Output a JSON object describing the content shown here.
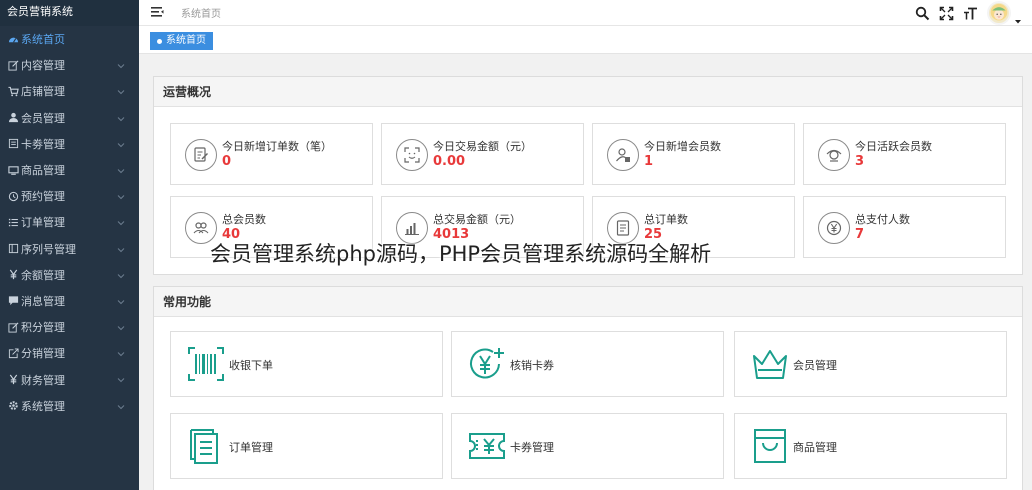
{
  "sidebar": {
    "brand": "会员营销系统",
    "items": [
      {
        "label": "系统首页",
        "icon": "dashboard-icon",
        "active": true
      },
      {
        "label": "内容管理",
        "icon": "edit-icon"
      },
      {
        "label": "店铺管理",
        "icon": "cart-icon"
      },
      {
        "label": "会员管理",
        "icon": "user-icon"
      },
      {
        "label": "卡劵管理",
        "icon": "card-icon"
      },
      {
        "label": "商品管理",
        "icon": "monitor-icon"
      },
      {
        "label": "预约管理",
        "icon": "clock-icon"
      },
      {
        "label": "订单管理",
        "icon": "list-icon"
      },
      {
        "label": "序列号管理",
        "icon": "serial-icon"
      },
      {
        "label": "余额管理",
        "icon": "yen-icon"
      },
      {
        "label": "消息管理",
        "icon": "message-icon"
      },
      {
        "label": "积分管理",
        "icon": "points-icon"
      },
      {
        "label": "分销管理",
        "icon": "share-icon"
      },
      {
        "label": "财务管理",
        "icon": "finance-yen-icon"
      },
      {
        "label": "系统管理",
        "icon": "gear-icon"
      }
    ]
  },
  "topbar": {
    "breadcrumb": "系统首页",
    "icons": [
      "search-icon",
      "fullscreen-icon",
      "font-size-icon",
      "avatar",
      "chevron-down-icon"
    ]
  },
  "tabs": [
    {
      "label": "系统首页"
    }
  ],
  "overview": {
    "title": "运营概况",
    "stats": [
      {
        "label": "今日新增订单数（笔）",
        "value": "0",
        "icon": "order-edit-icon"
      },
      {
        "label": "今日交易金额（元）",
        "value": "0.00",
        "icon": "scan-icon"
      },
      {
        "label": "今日新增会员数",
        "value": "1",
        "icon": "member-add-icon"
      },
      {
        "label": "今日活跃会员数",
        "value": "3",
        "icon": "active-member-icon"
      },
      {
        "label": "总会员数",
        "value": "40",
        "icon": "group-icon"
      },
      {
        "label": "总交易金额（元）",
        "value": "4013",
        "icon": "bar-chart-icon"
      },
      {
        "label": "总订单数",
        "value": "25",
        "icon": "document-icon"
      },
      {
        "label": "总支付人数",
        "value": "7",
        "icon": "yen-circle-icon"
      }
    ]
  },
  "functions": {
    "title": "常用功能",
    "items": [
      {
        "label": "收银下单",
        "icon": "barcode-icon"
      },
      {
        "label": "核销卡券",
        "icon": "redeem-coupon-icon"
      },
      {
        "label": "会员管理",
        "icon": "crown-icon"
      },
      {
        "label": "订单管理",
        "icon": "order-list-icon"
      },
      {
        "label": "卡券管理",
        "icon": "ticket-icon"
      },
      {
        "label": "商品管理",
        "icon": "shopping-bag-icon"
      }
    ]
  },
  "watermark": "会员管理系统php源码，PHP会员管理系统源码全解析",
  "colors": {
    "sidebar_bg": "#253444",
    "accent_blue": "#3b8ee0",
    "value_red": "#e8393a",
    "func_icon_teal": "#1a9e8c"
  }
}
